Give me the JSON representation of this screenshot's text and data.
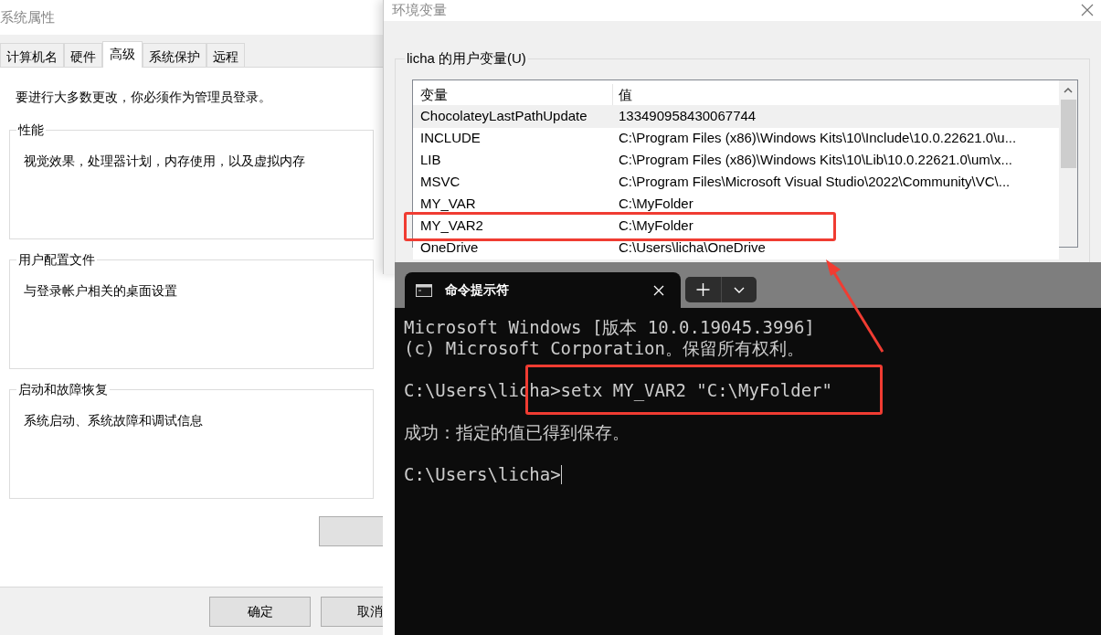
{
  "system_properties": {
    "title": "系统属性",
    "tabs": [
      {
        "label": "计算机名",
        "selected": false
      },
      {
        "label": "硬件",
        "selected": false
      },
      {
        "label": "高级",
        "selected": true
      },
      {
        "label": "系统保护",
        "selected": false
      },
      {
        "label": "远程",
        "selected": false
      }
    ],
    "notice": "要进行大多数更改，你必须作为管理员登录。",
    "groups": [
      {
        "title": "性能",
        "text": "视觉效果，处理器计划，内存使用，以及虚拟内存"
      },
      {
        "title": "用户配置文件",
        "text": "与登录帐户相关的桌面设置"
      },
      {
        "title": "启动和故障恢复",
        "text": "系统启动、系统故障和调试信息"
      }
    ],
    "footer_buttons": [
      "确定",
      "取消"
    ]
  },
  "environment_variables": {
    "title": "环境变量",
    "group_label": "licha 的用户变量(U)",
    "columns": [
      "变量",
      "值"
    ],
    "rows": [
      {
        "name": "ChocolateyLastPathUpdate",
        "value": "133490958430067744",
        "selected": true,
        "annotated": false
      },
      {
        "name": "INCLUDE",
        "value": "C:\\Program Files (x86)\\Windows Kits\\10\\Include\\10.0.22621.0\\u...",
        "selected": false,
        "annotated": false
      },
      {
        "name": "LIB",
        "value": "C:\\Program Files (x86)\\Windows Kits\\10\\Lib\\10.0.22621.0\\um\\x...",
        "selected": false,
        "annotated": false
      },
      {
        "name": "MSVC",
        "value": "C:\\Program Files\\Microsoft Visual Studio\\2022\\Community\\VC\\...",
        "selected": false,
        "annotated": false
      },
      {
        "name": "MY_VAR",
        "value": "C:\\MyFolder",
        "selected": false,
        "annotated": false
      },
      {
        "name": "MY_VAR2",
        "value": "C:\\MyFolder",
        "selected": false,
        "annotated": true
      },
      {
        "name": "OneDrive",
        "value": "C:\\Users\\licha\\OneDrive",
        "selected": false,
        "annotated": false
      }
    ]
  },
  "terminal": {
    "tab_title": "命令提示符",
    "blocks": [
      {
        "lines": [
          "Microsoft Windows [版本 10.0.19045.3996]",
          "(c) Microsoft Corporation。保留所有权利。"
        ],
        "annotated": false,
        "cursor": false
      },
      {
        "lines": [
          "C:\\Users\\licha>setx MY_VAR2 \"C:\\MyFolder\""
        ],
        "annotated": true,
        "cursor": false
      },
      {
        "lines": [
          "成功：指定的值已得到保存。"
        ],
        "annotated": false,
        "cursor": false
      },
      {
        "lines": [
          "C:\\Users\\licha>"
        ],
        "annotated": false,
        "cursor": true
      }
    ]
  }
}
